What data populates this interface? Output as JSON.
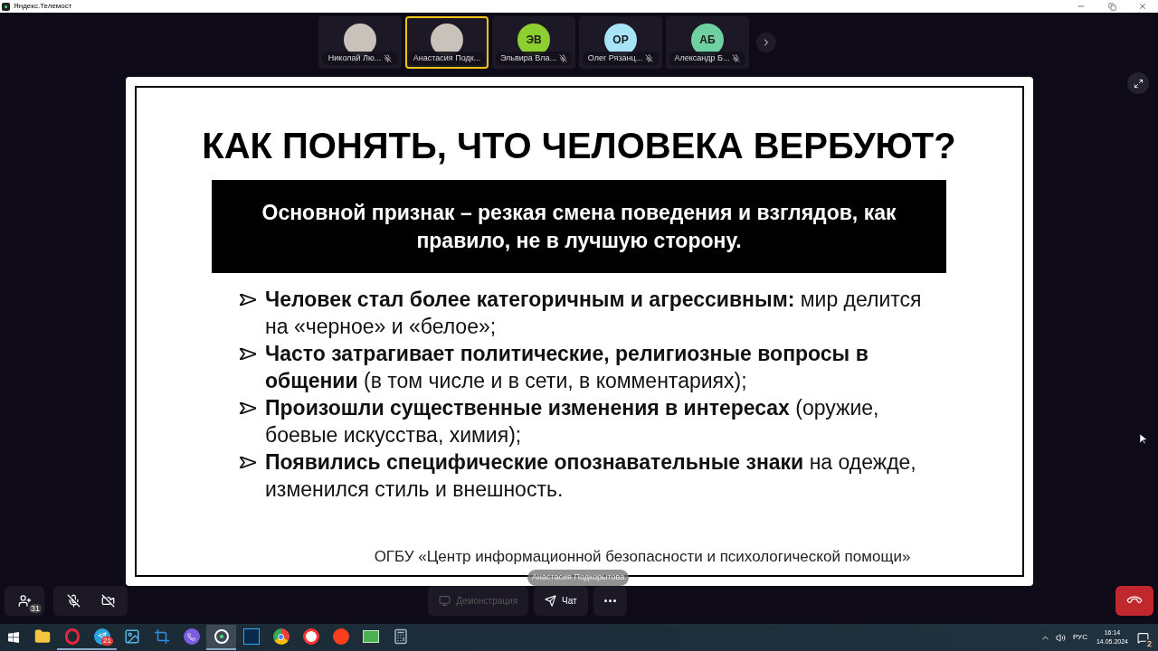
{
  "window": {
    "title": "Яндекс.Телемост"
  },
  "participants": [
    {
      "name": "Николай Лю...",
      "kind": "photo",
      "muted": true,
      "speaking": false
    },
    {
      "name": "Анастасия Подк...",
      "kind": "photo",
      "muted": false,
      "speaking": true
    },
    {
      "name": "Эльвира Вла...",
      "kind": "initials",
      "initials": "ЭВ",
      "color": "#8ccf2e",
      "muted": true,
      "speaking": false
    },
    {
      "name": "Олег Рязанц...",
      "kind": "initials",
      "initials": "ОР",
      "color": "#a8e4f7",
      "muted": true,
      "speaking": false
    },
    {
      "name": "Александр Б...",
      "kind": "initials",
      "initials": "АБ",
      "color": "#6fd0a0",
      "muted": true,
      "speaking": false
    }
  ],
  "slide": {
    "title": "КАК ПОНЯТЬ, ЧТО ЧЕЛОВЕКА ВЕРБУЮТ?",
    "highlight": "Основной признак – резкая смена поведения и взглядов, как правило, не в лучшую сторону.",
    "bullets": [
      "**Человек стал более категоричным и агрессивным:** мир делится на «черное» и «белое»;",
      "**Часто затрагивает политические, религиозные вопросы в общении** (в том числе и в сети, в комментариях);",
      "**Произошли существенные изменения в интересах** (оружие, боевые искусства, химия);",
      "**Появились специфические опознавательные знаки** на одежде, изменился стиль и внешность."
    ],
    "footer": "ОГБУ «Центр информационной безопасности и психологической помощи»"
  },
  "presenter_label": "Анастасия Подкорытова",
  "controls": {
    "participants_badge": "31",
    "mic_on": false,
    "camera_on": false,
    "demo": {
      "label": "Демонстрация",
      "disabled": true
    },
    "chat": {
      "label": "Чат"
    }
  },
  "taskbar": {
    "apps": [
      {
        "kind": "explorer",
        "running": false,
        "active": false
      },
      {
        "kind": "opera",
        "running": true,
        "active": false
      },
      {
        "kind": "telegram",
        "running": true,
        "active": false,
        "badge": "21"
      },
      {
        "kind": "photos",
        "running": false,
        "active": false
      },
      {
        "kind": "snip",
        "running": false,
        "active": false
      },
      {
        "kind": "viber",
        "running": false,
        "active": false
      },
      {
        "kind": "telemost",
        "running": true,
        "active": true
      },
      {
        "kind": "photoshop",
        "running": false,
        "active": false
      },
      {
        "kind": "chrome",
        "running": false,
        "active": false
      },
      {
        "kind": "yabrowser",
        "running": false,
        "active": false
      },
      {
        "kind": "yandex",
        "running": false,
        "active": false
      },
      {
        "kind": "money",
        "running": false,
        "active": false
      },
      {
        "kind": "calculator",
        "running": false,
        "active": false
      }
    ],
    "language": "РУС",
    "time": "16:14",
    "date": "14.05.2024",
    "notifications": "2"
  }
}
